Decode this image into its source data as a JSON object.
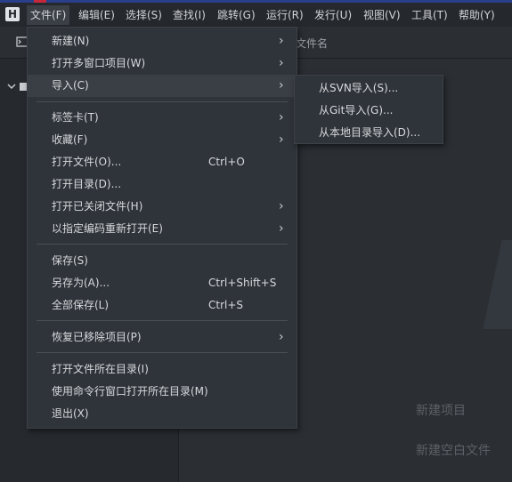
{
  "app": {
    "logo_letter": "H"
  },
  "menubar": {
    "items": [
      {
        "label": "文件(F)"
      },
      {
        "label": "编辑(E)"
      },
      {
        "label": "选择(S)"
      },
      {
        "label": "查找(I)"
      },
      {
        "label": "跳转(G)"
      },
      {
        "label": "运行(R)"
      },
      {
        "label": "发行(U)"
      },
      {
        "label": "视图(V)"
      },
      {
        "label": "工具(T)"
      },
      {
        "label": "帮助(Y)"
      }
    ]
  },
  "toolbar": {
    "file_name_label": "文件名",
    "left_icon": "terminal-icon"
  },
  "file_menu": {
    "items": [
      {
        "label": "新建(N)",
        "submenu": true
      },
      {
        "label": "打开多窗口项目(W)",
        "submenu": true
      },
      {
        "label": "导入(C)",
        "submenu": true
      },
      {
        "label": "标签卡(T)",
        "submenu": true
      },
      {
        "label": "收藏(F)",
        "submenu": true
      },
      {
        "label": "打开文件(O)...",
        "shortcut": "Ctrl+O"
      },
      {
        "label": "打开目录(D)..."
      },
      {
        "label": "打开已关闭文件(H)",
        "submenu": true
      },
      {
        "label": "以指定编码重新打开(E)",
        "submenu": true
      },
      {
        "label": "保存(S)"
      },
      {
        "label": "另存为(A)...",
        "shortcut": "Ctrl+Shift+S"
      },
      {
        "label": "全部保存(L)",
        "shortcut": "Ctrl+S"
      },
      {
        "label": "恢复已移除项目(P)",
        "submenu": true
      },
      {
        "label": "打开文件所在目录(I)"
      },
      {
        "label": "使用命令行窗口打开所在目录(M)"
      },
      {
        "label": "退出(X)"
      }
    ]
  },
  "import_submenu": {
    "items": [
      {
        "label": "从SVN导入(S)..."
      },
      {
        "label": "从Git导入(G)..."
      },
      {
        "label": "从本地目录导入(D)..."
      }
    ]
  },
  "editor": {
    "hint_new_project": "新建项目",
    "hint_new_blank_file": "新建空白文件"
  },
  "colors": {
    "accent_bar": "#2a3f8c",
    "menu_bg": "#2f343a",
    "hover_bg": "#3a3f45"
  }
}
